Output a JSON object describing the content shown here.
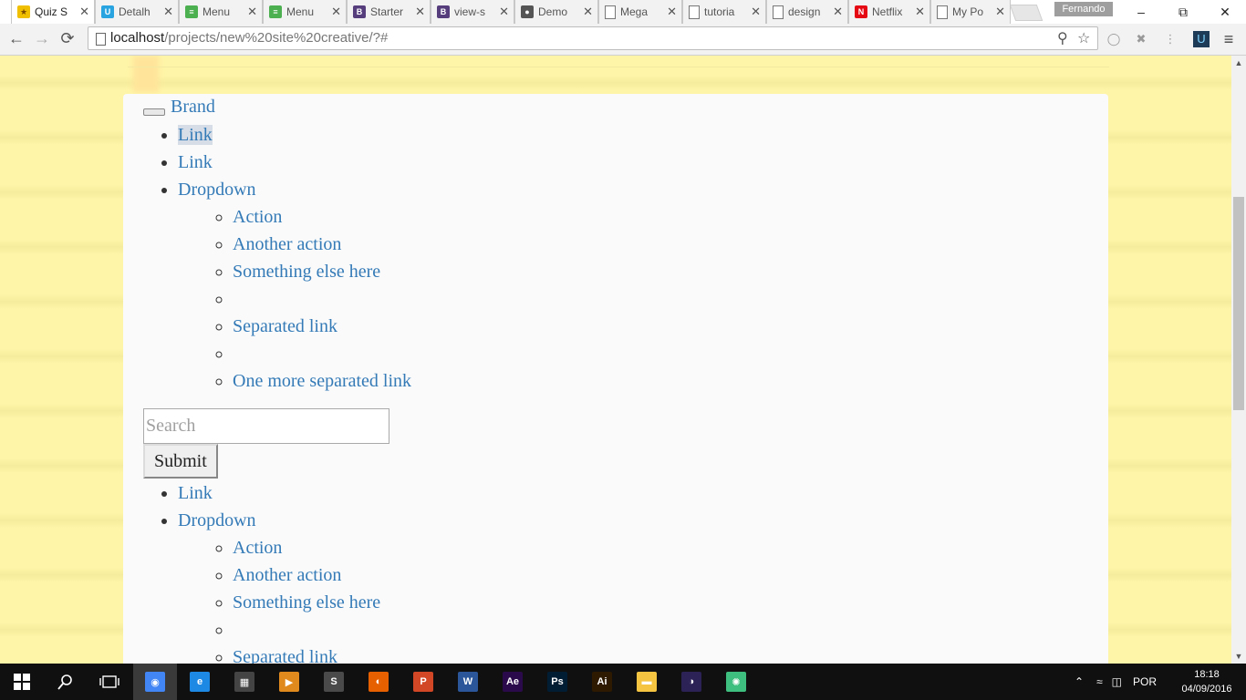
{
  "browser": {
    "tabs": [
      {
        "title": "Quiz Sl",
        "icon": "star-favicon",
        "color": "#f0c000",
        "glyph": "★",
        "active": true
      },
      {
        "title": "Detalh",
        "icon": "u-favicon",
        "color": "#2aa4e0",
        "glyph": "U"
      },
      {
        "title": "Menu",
        "icon": "sheet-favicon",
        "color": "#4caf50",
        "glyph": "≡"
      },
      {
        "title": "Menu",
        "icon": "sheet-favicon",
        "color": "#4caf50",
        "glyph": "≡"
      },
      {
        "title": "Starter",
        "icon": "bootstrap-favicon",
        "color": "#563d7c",
        "glyph": "B"
      },
      {
        "title": "view-s",
        "icon": "bootstrap-favicon",
        "color": "#563d7c",
        "glyph": "B"
      },
      {
        "title": "Demo",
        "icon": "chat-favicon",
        "color": "#555555",
        "glyph": "●"
      },
      {
        "title": "Mega",
        "icon": "page-favicon",
        "color": "#ffffff",
        "glyph": ""
      },
      {
        "title": "tutoria",
        "icon": "page-favicon",
        "color": "#ffffff",
        "glyph": ""
      },
      {
        "title": "design",
        "icon": "page-favicon",
        "color": "#ffffff",
        "glyph": ""
      },
      {
        "title": "Netflix",
        "icon": "netflix-favicon",
        "color": "#e50914",
        "glyph": "N"
      },
      {
        "title": "My Po",
        "icon": "page-favicon",
        "color": "#ffffff",
        "glyph": ""
      }
    ],
    "profile": "Fernando",
    "url_host": "localhost",
    "url_rest": "/projects/new%20site%20creative/?#"
  },
  "navbar": {
    "brand": "Brand",
    "menu1": {
      "items": [
        "Link",
        "Link",
        "Dropdown"
      ],
      "dropdown": [
        "Action",
        "Another action",
        "Something else here",
        "",
        "Separated link",
        "",
        "One more separated link"
      ]
    },
    "search_placeholder": "Search",
    "submit": "Submit",
    "menu2": {
      "items": [
        "Link",
        "Dropdown"
      ],
      "dropdown": [
        "Action",
        "Another action",
        "Something else here",
        "",
        "Separated link"
      ]
    }
  },
  "taskbar": {
    "apps": [
      {
        "name": "chrome-app-icon",
        "glyph": "◉",
        "color": "#4285f4",
        "active": true
      },
      {
        "name": "edge-app-icon",
        "glyph": "e",
        "color": "#1e88e5"
      },
      {
        "name": "store-app-icon",
        "glyph": "▦",
        "color": "#444444"
      },
      {
        "name": "media-player-app-icon",
        "glyph": "▶",
        "color": "#e08a1e"
      },
      {
        "name": "sublime-app-icon",
        "glyph": "S",
        "color": "#4a4a4a"
      },
      {
        "name": "firefox-app-icon",
        "glyph": "◐",
        "color": "#e66000"
      },
      {
        "name": "powerpoint-app-icon",
        "glyph": "P",
        "color": "#d24726"
      },
      {
        "name": "word-app-icon",
        "glyph": "W",
        "color": "#2b579a"
      },
      {
        "name": "after-effects-app-icon",
        "glyph": "Ae",
        "color": "#2a0a4a"
      },
      {
        "name": "photoshop-app-icon",
        "glyph": "Ps",
        "color": "#001d34"
      },
      {
        "name": "illustrator-app-icon",
        "glyph": "Ai",
        "color": "#2d1a00"
      },
      {
        "name": "file-explorer-app-icon",
        "glyph": "▬",
        "color": "#f5c542"
      },
      {
        "name": "eclipse-app-icon",
        "glyph": "◑",
        "color": "#2c2255"
      },
      {
        "name": "atom-app-icon",
        "glyph": "✺",
        "color": "#3fbf7f"
      }
    ],
    "language": "POR",
    "time": "18:18",
    "date": "04/09/2016"
  }
}
